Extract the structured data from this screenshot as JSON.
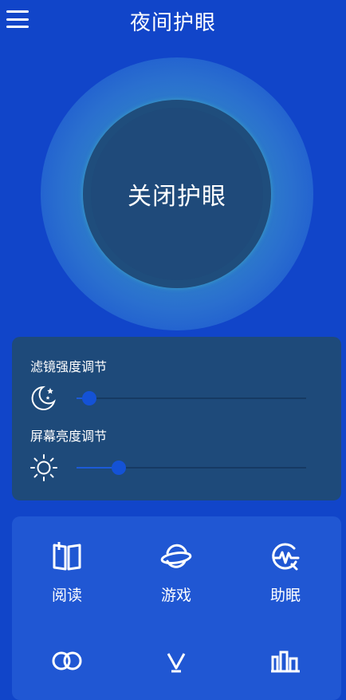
{
  "header": {
    "title": "夜间护眼",
    "menu_icon": "hamburger-menu-icon"
  },
  "toggle": {
    "label": "关闭护眼"
  },
  "sliders": {
    "filter": {
      "label": "滤镜强度调节",
      "icon": "moon-stars-icon",
      "value_fraction": 0.0
    },
    "brightness": {
      "label": "屏幕亮度调节",
      "icon": "sun-icon",
      "value_fraction": 0.135
    }
  },
  "modes": [
    {
      "label": "阅读",
      "icon": "book-icon"
    },
    {
      "label": "游戏",
      "icon": "planet-icon"
    },
    {
      "label": "助眠",
      "icon": "sleep-wave-icon"
    },
    {
      "label": "",
      "icon": "rings-icon"
    },
    {
      "label": "",
      "icon": "lamp-icon"
    },
    {
      "label": "",
      "icon": "city-icon"
    }
  ],
  "colors": {
    "background": "#1145c9",
    "panel_dark": "#1e4a7a",
    "panel_blue": "#2057d3",
    "accent": "#1452d6",
    "ring_glow": "#3fb2b4"
  }
}
